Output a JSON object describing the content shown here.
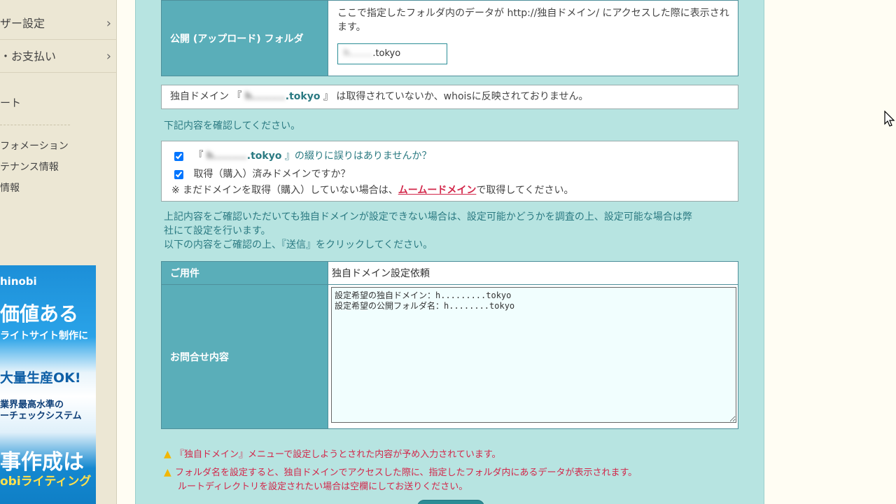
{
  "sidebar": {
    "items": [
      {
        "label": "ザー設定"
      },
      {
        "label": "・お支払い"
      }
    ],
    "chev": "›",
    "link_top": "ート",
    "links": [
      "フォメーション",
      "テナンス情報",
      "情報"
    ]
  },
  "banner": {
    "brand": "hinobi",
    "line1": "価値ある",
    "line2": "ライトサイト制作に",
    "line3": "大量生産OK!",
    "line4": "業界最高水準の",
    "line5": "ーチェックシステム",
    "line6": "事作成は",
    "line7": "obiライティング"
  },
  "public_folder": {
    "label": "公開 (アップロード) フォルダ",
    "desc": "ここで指定したフォルダ内のデータが http://独自ドメイン/ にアクセスした際に表示されます。",
    "value_blur": "h........",
    "value_suffix": ".tokyo"
  },
  "domain_notice": {
    "prefix": "独自ドメイン 『",
    "domain_blur": "h.........",
    "domain_suffix": ".tokyo",
    "suffix": "』 は取得されていないか、whoisに反映されておりません。"
  },
  "confirm_heading": "下記内容を確認してください。",
  "checklist": {
    "item1_prefix": "『",
    "item1_blur": "h.........",
    "item1_domain": ".tokyo",
    "item1_suffix": "』の綴りに誤りはありませんか？",
    "item2": "取得（購入）済みドメインですか？",
    "note_prefix": "※ まだドメインを取得（購入）していない場合は、",
    "note_link": "ムームードメイン",
    "note_suffix": "で取得してください。"
  },
  "para": {
    "line1": "上記内容をご確認いただいても独自ドメインが設定できない場合は、設定可能かどうかを調査の上、設定可能な場合は弊",
    "line2": "社にて設定を行います。",
    "line3": "以下の内容をご確認の上、『送信』をクリックしてください。"
  },
  "form": {
    "subject_label": "ご用件",
    "subject_value": "独自ドメイン設定依頼",
    "content_label": "お問合せ内容",
    "content_value": "設定希望の独自ドメイン：h.........tokyo\n設定希望の公開フォルダ名：h........tokyo"
  },
  "warnings": {
    "w1": "『独自ドメイン』メニューで設定しようとされた内容が予め入力されています。",
    "w2a": "フォルダ名を設定すると、独自ドメインでアクセスした際に、指定したフォルダ内にあるデータが表示されます。",
    "w2b": "ルートディレクトリを設定されたい場合は空欄にしてお送りください。"
  },
  "colors": {
    "panel": "#b7e4e1",
    "header_cell": "#5aaeb9",
    "warning": "#d2274a",
    "link": "#d2274a"
  }
}
